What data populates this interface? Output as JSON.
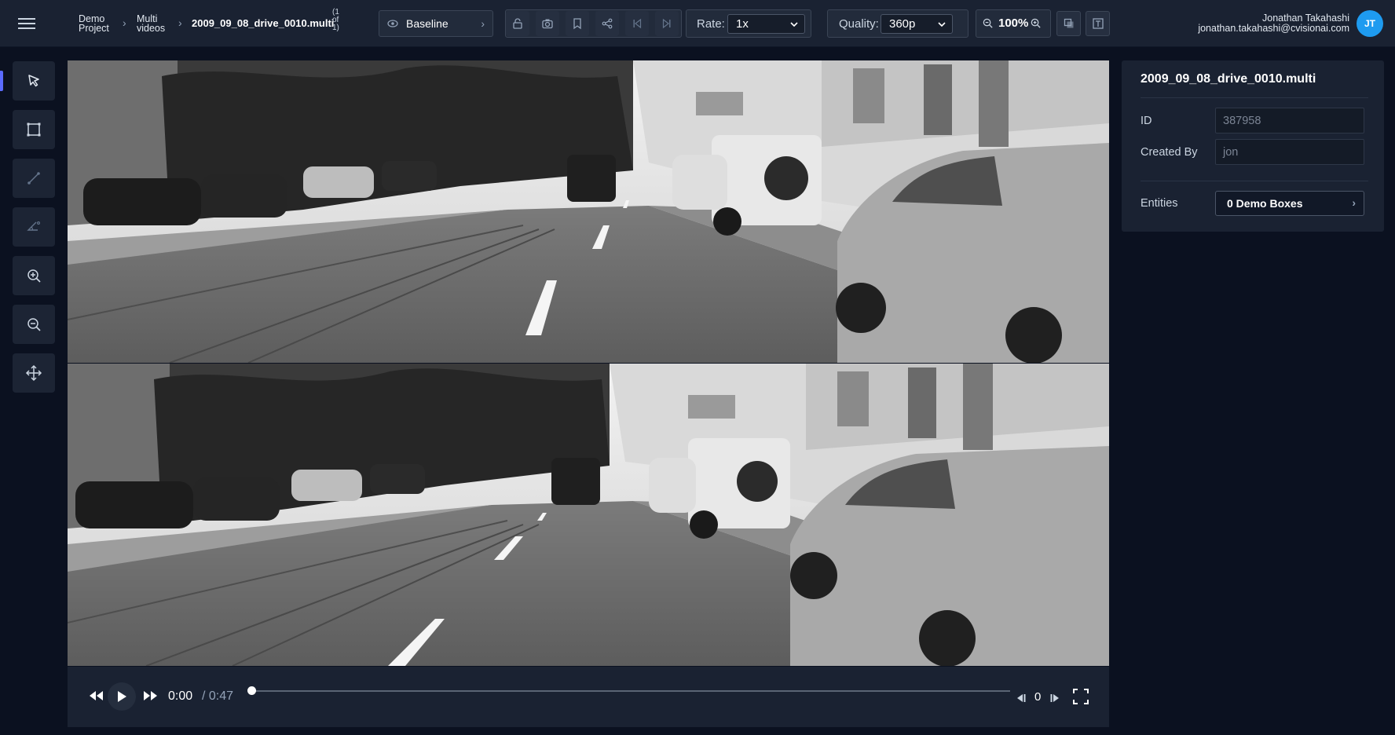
{
  "header": {
    "breadcrumbs": [
      {
        "line1": "Demo",
        "line2": "Project"
      },
      {
        "line1": "Multi",
        "line2": "videos"
      }
    ],
    "file_name": "2009_09_08_drive_0010.multi",
    "file_count": {
      "line1": "(1",
      "line2": "of",
      "line3": "1)"
    },
    "view_mode": "Baseline",
    "rate_label": "Rate:",
    "rate_value": "1x",
    "quality_label": "Quality:",
    "quality_value": "360p",
    "zoom_value": "100%",
    "user": {
      "name": "Jonathan Takahashi",
      "email": "jonathan.takahashi@cvisionai.com",
      "initials": "JT"
    }
  },
  "tools": [
    {
      "name": "select-tool",
      "icon": "cursor-arrow-icon",
      "active": true
    },
    {
      "name": "box-tool",
      "icon": "bounding-box-icon"
    },
    {
      "name": "line-tool",
      "icon": "line-icon"
    },
    {
      "name": "poly-tool",
      "icon": "angle-icon"
    },
    {
      "name": "zoom-in-tool",
      "icon": "zoom-in-icon"
    },
    {
      "name": "zoom-out-tool",
      "icon": "zoom-out-icon"
    },
    {
      "name": "pan-tool",
      "icon": "move-arrows-icon"
    }
  ],
  "player": {
    "current_time": "0:00",
    "total_time": "/ 0:47",
    "frame_number": "0",
    "progress": 0
  },
  "info_panel": {
    "title": "2009_09_08_drive_0010.multi",
    "fields": [
      {
        "label": "ID",
        "value": "387958"
      },
      {
        "label": "Created By",
        "value": "jon"
      }
    ],
    "entities_label": "Entities",
    "entities_value": "0 Demo Boxes"
  },
  "colors": {
    "background": "#0b1120",
    "panel": "#1a2232",
    "accent": "#1e9bf0",
    "active_indicator": "#5b6bff"
  }
}
